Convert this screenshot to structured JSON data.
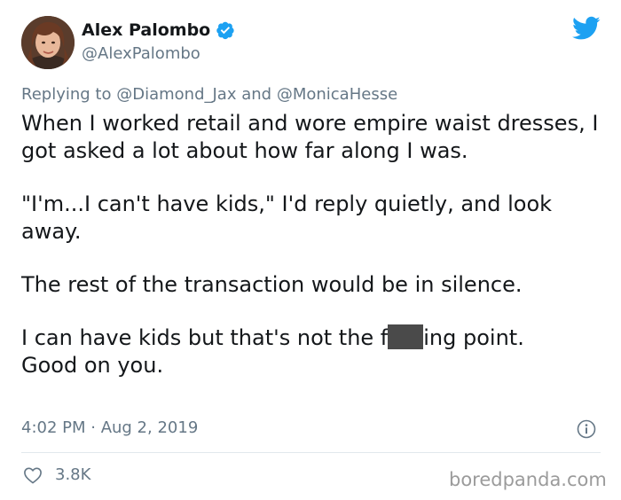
{
  "author": {
    "display_name": "Alex Palombo",
    "handle": "@AlexPalombo",
    "avatar_icon": "profile-photo",
    "verified": true
  },
  "brand": {
    "icon": "twitter-bird-icon",
    "color": "#1da1f2"
  },
  "reply": {
    "prefix": "Replying to",
    "mention_1": "@Diamond_Jax",
    "joiner": "and",
    "mention_2": "@MonicaHesse"
  },
  "body": {
    "paragraph_1": "When I worked retail and wore empire waist dresses, I got asked a lot about how far along I was.",
    "paragraph_2": "\"I'm...I can't have kids,\" I'd reply quietly, and look away.",
    "paragraph_3": "The rest of the transaction would be in silence.",
    "paragraph_4_start": "I can have kids but that's not the f",
    "paragraph_4_end": "ing point.",
    "paragraph_4_line_2": "Good on you."
  },
  "meta": {
    "timestamp": "4:02 PM · Aug 2, 2019",
    "info_icon": "info-icon"
  },
  "engagement": {
    "likes": "3.8K",
    "like_icon": "heart-icon"
  },
  "watermark": {
    "text": "boredpanda.com"
  },
  "colors": {
    "text_primary": "#14171a",
    "text_secondary": "#657786",
    "divider": "#e1e8ed",
    "censor_bar": "#4a4a4a"
  }
}
